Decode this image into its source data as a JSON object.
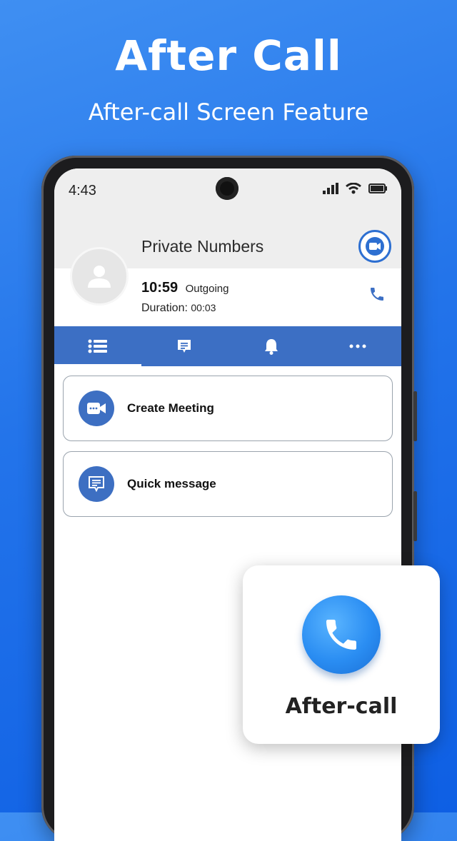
{
  "promo": {
    "headline": "After Call",
    "subheadline": "After-call Screen Feature"
  },
  "status_bar": {
    "time": "4:43",
    "icons": [
      "signal-icon",
      "wifi-icon",
      "battery-icon"
    ]
  },
  "call": {
    "contact_name": "Private Numbers",
    "time": "10:59",
    "type": "Outgoing",
    "duration_label": "Duration:",
    "duration_value": "00:03"
  },
  "tabs": [
    {
      "icon": "list-icon",
      "active": true
    },
    {
      "icon": "message-icon",
      "active": false
    },
    {
      "icon": "bell-icon",
      "active": false
    },
    {
      "icon": "more-icon",
      "active": false
    }
  ],
  "actions": [
    {
      "label": "Create Meeting",
      "icon": "video-meeting-icon"
    },
    {
      "label": "Quick message",
      "icon": "message-icon"
    }
  ],
  "badge": {
    "label": "After-call",
    "icon": "phone-icon"
  },
  "colors": {
    "background": "#2374ea",
    "accent": "#3c6fc4",
    "badge_blue": "#2a8df2"
  }
}
